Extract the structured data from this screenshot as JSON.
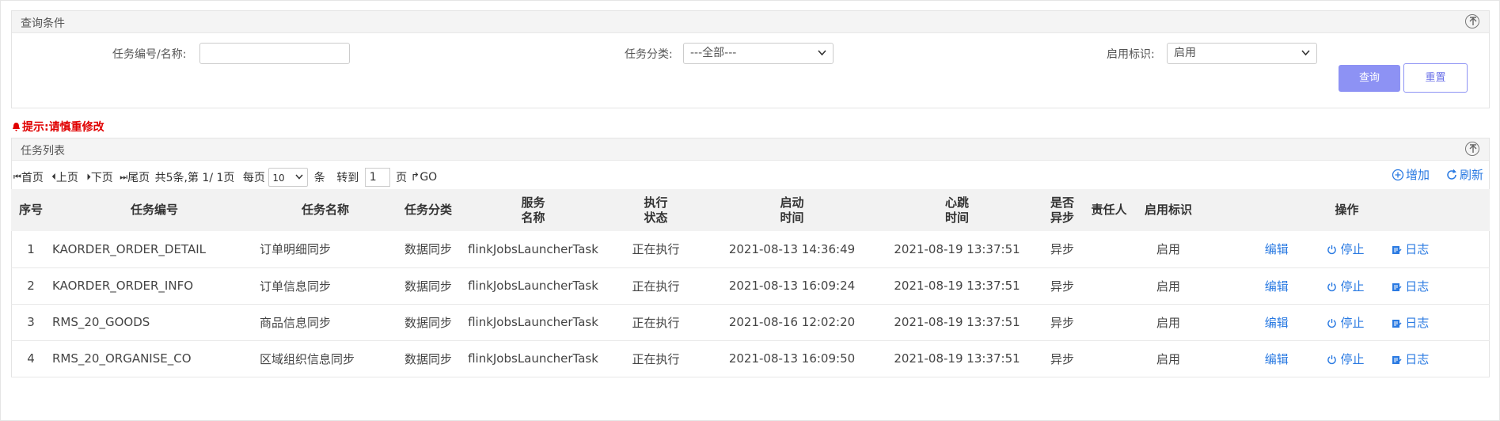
{
  "query": {
    "title": "查询条件",
    "fields": {
      "task_code_label": "任务编号/名称:",
      "task_code_value": "",
      "category_label": "任务分类:",
      "category_selected": "---全部---",
      "enable_label": "启用标识:",
      "enable_selected": "启用"
    },
    "buttons": {
      "query": "查询",
      "reset": "重置"
    }
  },
  "warning": "提示:请慎重修改",
  "list": {
    "title": "任务列表",
    "pager": {
      "first": "首页",
      "prev": "上页",
      "next": "下页",
      "last": "尾页",
      "summary": "共5条,第 1/ 1页",
      "per_page": "每页",
      "page_size": "10",
      "unit": "条",
      "goto": "转到",
      "page_value": "1",
      "page_unit": "页",
      "go": "GO"
    },
    "toolbar": {
      "add": "增加",
      "refresh": "刷新"
    },
    "columns": [
      "序号",
      "任务编号",
      "任务名称",
      "任务分类",
      "服务\n名称",
      "执行\n状态",
      "启动\n时间",
      "心跳\n时间",
      "是否\n异步",
      "责任人",
      "启用标识",
      "操作"
    ],
    "rows": [
      {
        "no": "1",
        "code": "KAORDER_ORDER_DETAIL",
        "name": "订单明细同步",
        "category": "数据同步",
        "service": "flinkJobsLauncherTask",
        "status": "正在执行",
        "start": "2021-08-13 14:36:49",
        "heartbeat": "2021-08-19 13:37:51",
        "async": "异步",
        "owner": "",
        "enabled": "启用",
        "edit": "编辑",
        "stop": "停止",
        "log": "日志"
      },
      {
        "no": "2",
        "code": "KAORDER_ORDER_INFO",
        "name": "订单信息同步",
        "category": "数据同步",
        "service": "flinkJobsLauncherTask",
        "status": "正在执行",
        "start": "2021-08-13 16:09:24",
        "heartbeat": "2021-08-19 13:37:51",
        "async": "异步",
        "owner": "",
        "enabled": "启用",
        "edit": "编辑",
        "stop": "停止",
        "log": "日志"
      },
      {
        "no": "3",
        "code": "RMS_20_GOODS",
        "name": "商品信息同步",
        "category": "数据同步",
        "service": "flinkJobsLauncherTask",
        "status": "正在执行",
        "start": "2021-08-16 12:02:20",
        "heartbeat": "2021-08-19 13:37:51",
        "async": "异步",
        "owner": "",
        "enabled": "启用",
        "edit": "编辑",
        "stop": "停止",
        "log": "日志"
      },
      {
        "no": "4",
        "code": "RMS_20_ORGANISE_CO",
        "name": "区域组织信息同步",
        "category": "数据同步",
        "service": "flinkJobsLauncherTask",
        "status": "正在执行",
        "start": "2021-08-13 16:09:50",
        "heartbeat": "2021-08-19 13:37:51",
        "async": "异步",
        "owner": "",
        "enabled": "启用",
        "edit": "编辑",
        "stop": "停止",
        "log": "日志"
      }
    ]
  },
  "colors": {
    "accent": "#8d92f4",
    "link": "#2a7ae2",
    "running": "#0fbf0f",
    "async": "#5b4ff0",
    "warning": "#e00000"
  }
}
